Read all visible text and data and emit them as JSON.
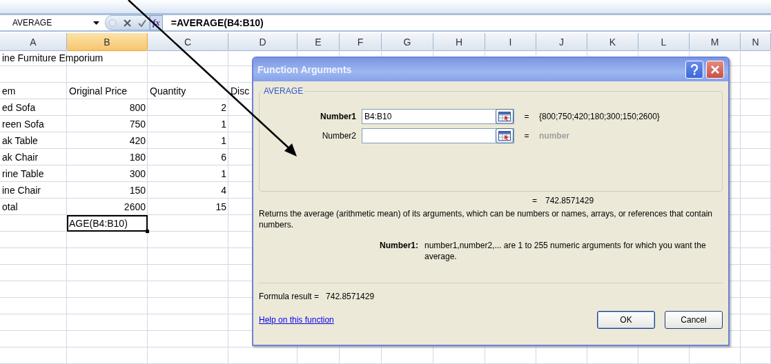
{
  "formula_bar": {
    "name_box": "AVERAGE",
    "fx": "fx",
    "formula": "=AVERAGE(B4:B10)"
  },
  "columns": [
    {
      "label": "A",
      "selected": false
    },
    {
      "label": "B",
      "selected": true
    },
    {
      "label": "C",
      "selected": false
    },
    {
      "label": "D",
      "selected": false
    },
    {
      "label": "E",
      "selected": false
    },
    {
      "label": "F",
      "selected": false
    },
    {
      "label": "G",
      "selected": false
    },
    {
      "label": "H",
      "selected": false
    },
    {
      "label": "I",
      "selected": false
    },
    {
      "label": "J",
      "selected": false
    },
    {
      "label": "K",
      "selected": false
    },
    {
      "label": "L",
      "selected": false
    },
    {
      "label": "M",
      "selected": false
    },
    {
      "label": "N",
      "selected": false
    }
  ],
  "rows": [
    {
      "cells": {
        "A": {
          "text": "ine Furniture Emporium",
          "editing": false
        }
      }
    },
    {
      "cells": {}
    },
    {
      "cells": {
        "A": {
          "text": "em",
          "editing": false
        },
        "B": {
          "text": "Original Price",
          "editing": false
        },
        "C": {
          "text": "Quantity",
          "editing": false
        },
        "D": {
          "text": "Disc",
          "editing": false
        }
      }
    },
    {
      "cells": {
        "A": {
          "text": "ed Sofa",
          "editing": false
        },
        "B": {
          "text": "800",
          "kind": "number",
          "editing": false
        },
        "C": {
          "text": "2",
          "kind": "number",
          "editing": false
        }
      }
    },
    {
      "cells": {
        "A": {
          "text": "reen Sofa",
          "editing": false
        },
        "B": {
          "text": "750",
          "kind": "number",
          "editing": false
        },
        "C": {
          "text": "1",
          "kind": "number",
          "editing": false
        }
      }
    },
    {
      "cells": {
        "A": {
          "text": "ak Table",
          "editing": false
        },
        "B": {
          "text": "420",
          "kind": "number",
          "editing": false
        },
        "C": {
          "text": "1",
          "kind": "number",
          "editing": false
        }
      }
    },
    {
      "cells": {
        "A": {
          "text": "ak Chair",
          "editing": false
        },
        "B": {
          "text": "180",
          "kind": "number",
          "editing": false
        },
        "C": {
          "text": "6",
          "kind": "number",
          "editing": false
        }
      }
    },
    {
      "cells": {
        "A": {
          "text": "rine Table",
          "editing": false
        },
        "B": {
          "text": "300",
          "kind": "number",
          "editing": false
        },
        "C": {
          "text": "1",
          "kind": "number",
          "editing": false
        }
      }
    },
    {
      "cells": {
        "A": {
          "text": "ine Chair",
          "editing": false
        },
        "B": {
          "text": "150",
          "kind": "number",
          "editing": false
        },
        "C": {
          "text": "4",
          "kind": "number",
          "editing": false
        }
      }
    },
    {
      "cells": {
        "A": {
          "text": "otal",
          "editing": false
        },
        "B": {
          "text": "2600",
          "kind": "number",
          "editing": false
        },
        "C": {
          "text": "15",
          "kind": "number",
          "editing": false
        }
      }
    },
    {
      "cells": {
        "B": {
          "text": "AGE(B4:B10)",
          "editing": true
        }
      }
    }
  ],
  "dialog": {
    "title": "Function Arguments",
    "group": "AVERAGE",
    "arguments": [
      {
        "label": "Number1",
        "value": "B4:B10",
        "equals": "=",
        "result": "{800;750;420;180;300;150;2600}",
        "required": true
      },
      {
        "label": "Number2",
        "equals": "=",
        "result": "number",
        "required": false
      }
    ],
    "result_equals": "=",
    "result": "742.8571429",
    "description": "Returns the average (arithmetic mean) of its arguments, which can be numbers or names, arrays, or references that contain numbers.",
    "arg_help_label": "Number1:",
    "arg_help": "number1,number2,... are 1 to 255 numeric arguments for which you want the average.",
    "formula_result_label": "Formula result =",
    "formula_result": "742.8571429",
    "help_link": "Help on this function",
    "buttons": [
      {
        "label": "OK",
        "default": true
      },
      {
        "label": "Cancel",
        "default": false
      }
    ]
  }
}
